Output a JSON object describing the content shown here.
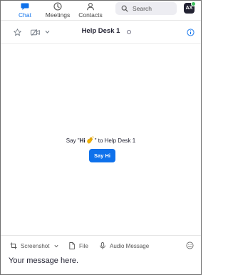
{
  "nav": {
    "tabs": [
      {
        "label": "Chat",
        "icon": "chat-icon",
        "active": true
      },
      {
        "label": "Meetings",
        "icon": "clock-icon",
        "active": false
      },
      {
        "label": "Contacts",
        "icon": "contacts-icon",
        "active": false
      }
    ],
    "search_placeholder": "Search",
    "avatar_initials": "AX"
  },
  "channel": {
    "title": "Help Desk 1",
    "star_icon": "star-icon",
    "video_icon": "video-icon",
    "info_icon": "info-icon"
  },
  "empty_state": {
    "prefix": "Say \"",
    "bold": "Hi",
    "suffix": "\" to Help Desk 1",
    "wave_icon": "waving-hand-icon",
    "button_label": "Say Hi"
  },
  "composer": {
    "screenshot_label": "Screenshot",
    "file_label": "File",
    "audio_label": "Audio Message",
    "placeholder": "Your message here."
  },
  "colors": {
    "accent": "#0e71eb",
    "presence": "#3fbf5f",
    "text": "#232333"
  }
}
